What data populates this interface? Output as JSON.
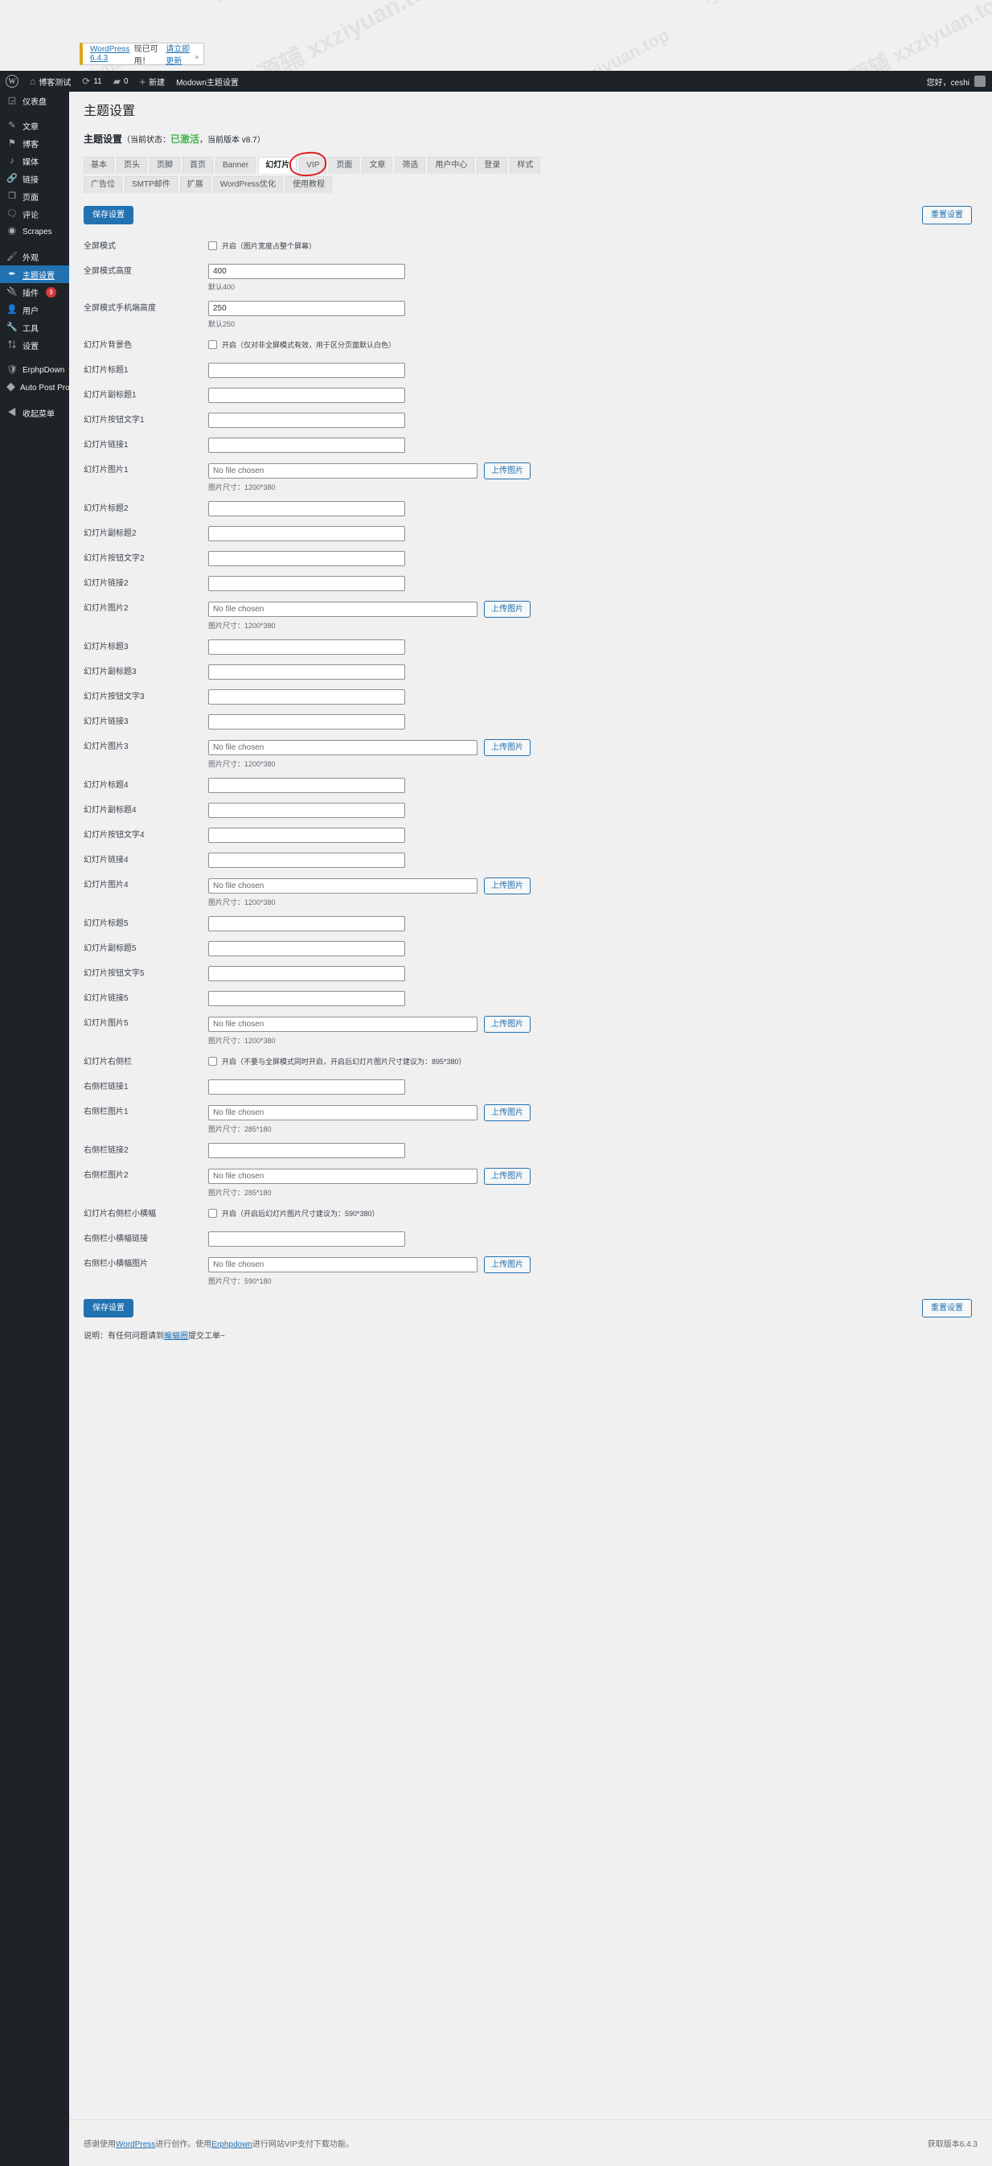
{
  "notice": {
    "text_prefix": "WordPress 6.4.3",
    "text_mid": "现已可用！",
    "link": "请立即更新",
    "text_suffix": "。"
  },
  "adminbar": {
    "logo_icon": "wordpress-logo-icon",
    "site_icon": "home-icon",
    "site_name": "博客测试",
    "updates_icon": "updates-icon",
    "updates_count": "11",
    "comments_icon": "comment-bubble-icon",
    "comments_count": "0",
    "new_icon": "plus-icon",
    "new_label": "新建",
    "theme_settings_label": "Modown主题设置",
    "greeting": "您好，ceshi",
    "avatar_icon": "avatar-icon"
  },
  "sidebar": {
    "items": [
      {
        "label": "仪表盘",
        "icon": "dashboard-icon",
        "glyph": "◲",
        "current": false,
        "badge": ""
      },
      {
        "label": "文章",
        "icon": "pin-icon",
        "glyph": "✎",
        "current": false,
        "badge": ""
      },
      {
        "label": "博客",
        "icon": "flag-icon",
        "glyph": "⚑",
        "current": false,
        "badge": ""
      },
      {
        "label": "媒体",
        "icon": "media-icon",
        "glyph": "♪",
        "current": false,
        "badge": ""
      },
      {
        "label": "链接",
        "icon": "link-icon",
        "glyph": "🔗",
        "current": false,
        "badge": ""
      },
      {
        "label": "页面",
        "icon": "page-icon",
        "glyph": "❐",
        "current": false,
        "badge": ""
      },
      {
        "label": "评论",
        "icon": "comment-icon",
        "glyph": "🗨",
        "current": false,
        "badge": ""
      },
      {
        "label": "Scrapes",
        "icon": "globe-cursor-icon",
        "glyph": "◉",
        "current": false,
        "badge": ""
      },
      {
        "label": "外观",
        "icon": "appearance-brush-icon",
        "glyph": "🖌",
        "current": false,
        "badge": ""
      },
      {
        "label": "主题设置",
        "icon": "theme-settings-icon",
        "glyph": "✒",
        "current": true,
        "badge": ""
      },
      {
        "label": "插件",
        "icon": "plugins-icon",
        "glyph": "🔌",
        "current": false,
        "badge": "9"
      },
      {
        "label": "用户",
        "icon": "users-icon",
        "glyph": "👤",
        "current": false,
        "badge": ""
      },
      {
        "label": "工具",
        "icon": "tools-wrench-icon",
        "glyph": "🔧",
        "current": false,
        "badge": ""
      },
      {
        "label": "设置",
        "icon": "settings-sliders-icon",
        "glyph": "⇅",
        "current": false,
        "badge": ""
      },
      {
        "label": "ErphpDown",
        "icon": "shield-icon",
        "glyph": "🛡",
        "current": false,
        "badge": ""
      },
      {
        "label": "Auto Post Pro",
        "icon": "autopost-icon",
        "glyph": "◆",
        "current": false,
        "badge": ""
      },
      {
        "label": "收起菜单",
        "icon": "collapse-icon",
        "glyph": "◀",
        "current": false,
        "badge": ""
      }
    ]
  },
  "page": {
    "title": "主题设置",
    "panel_title": "主题设置",
    "panel_meta_open": "（当前状态：",
    "panel_status": "已激活",
    "panel_meta_mid": "，当前版本 v8.7）"
  },
  "tabs": [
    {
      "label": "基本",
      "active": false
    },
    {
      "label": "页头",
      "active": false
    },
    {
      "label": "页脚",
      "active": false
    },
    {
      "label": "首页",
      "active": false
    },
    {
      "label": "Banner",
      "active": false
    },
    {
      "label": "幻灯片",
      "active": true
    },
    {
      "label": "VIP",
      "active": false
    },
    {
      "label": "页面",
      "active": false
    },
    {
      "label": "文章",
      "active": false
    },
    {
      "label": "筛选",
      "active": false
    },
    {
      "label": "用户中心",
      "active": false
    },
    {
      "label": "登录",
      "active": false
    },
    {
      "label": "样式",
      "active": false
    },
    {
      "label": "广告位",
      "active": false
    },
    {
      "label": "SMTP邮件",
      "active": false
    },
    {
      "label": "扩展",
      "active": false
    },
    {
      "label": "WordPress优化",
      "active": false
    },
    {
      "label": "使用教程",
      "active": false
    }
  ],
  "toolbar": {
    "save_label": "保存设置",
    "reset_label": "重置设置",
    "upload_label": "上传图片"
  },
  "form": {
    "rows": [
      {
        "type": "checkbox",
        "label": "全屏模式",
        "checked": false,
        "checkbox_text": "开启（图片宽度占整个屏幕）"
      },
      {
        "type": "text",
        "label": "全屏模式高度",
        "value": "400",
        "hint": "默认400",
        "wide": true
      },
      {
        "type": "text",
        "label": "全屏模式手机端高度",
        "value": "250",
        "hint": "默认250",
        "wide": true
      },
      {
        "type": "checkbox",
        "label": "幻灯片背景色",
        "checked": false,
        "checkbox_text": "开启（仅对非全屏模式有效，用于区分页面默认白色）"
      },
      {
        "type": "text",
        "label": "幻灯片标题1",
        "value": "",
        "hint": ""
      },
      {
        "type": "text",
        "label": "幻灯片副标题1",
        "value": "",
        "hint": ""
      },
      {
        "type": "text",
        "label": "幻灯片按钮文字1",
        "value": "",
        "hint": ""
      },
      {
        "type": "text",
        "label": "幻灯片链接1",
        "value": "",
        "hint": ""
      },
      {
        "type": "file",
        "label": "幻灯片图片1",
        "value": "No file chosen",
        "hint": "图片尺寸：1200*380"
      },
      {
        "type": "text",
        "label": "幻灯片标题2",
        "value": "",
        "hint": ""
      },
      {
        "type": "text",
        "label": "幻灯片副标题2",
        "value": "",
        "hint": ""
      },
      {
        "type": "text",
        "label": "幻灯片按钮文字2",
        "value": "",
        "hint": ""
      },
      {
        "type": "text",
        "label": "幻灯片链接2",
        "value": "",
        "hint": ""
      },
      {
        "type": "file",
        "label": "幻灯片图片2",
        "value": "No file chosen",
        "hint": "图片尺寸：1200*380"
      },
      {
        "type": "text",
        "label": "幻灯片标题3",
        "value": "",
        "hint": ""
      },
      {
        "type": "text",
        "label": "幻灯片副标题3",
        "value": "",
        "hint": ""
      },
      {
        "type": "text",
        "label": "幻灯片按钮文字3",
        "value": "",
        "hint": ""
      },
      {
        "type": "text",
        "label": "幻灯片链接3",
        "value": "",
        "hint": ""
      },
      {
        "type": "file",
        "label": "幻灯片图片3",
        "value": "No file chosen",
        "hint": "图片尺寸：1200*380"
      },
      {
        "type": "text",
        "label": "幻灯片标题4",
        "value": "",
        "hint": ""
      },
      {
        "type": "text",
        "label": "幻灯片副标题4",
        "value": "",
        "hint": ""
      },
      {
        "type": "text",
        "label": "幻灯片按钮文字4",
        "value": "",
        "hint": ""
      },
      {
        "type": "text",
        "label": "幻灯片链接4",
        "value": "",
        "hint": ""
      },
      {
        "type": "file",
        "label": "幻灯片图片4",
        "value": "No file chosen",
        "hint": "图片尺寸：1200*380"
      },
      {
        "type": "text",
        "label": "幻灯片标题5",
        "value": "",
        "hint": ""
      },
      {
        "type": "text",
        "label": "幻灯片副标题5",
        "value": "",
        "hint": ""
      },
      {
        "type": "text",
        "label": "幻灯片按钮文字5",
        "value": "",
        "hint": ""
      },
      {
        "type": "text",
        "label": "幻灯片链接5",
        "value": "",
        "hint": ""
      },
      {
        "type": "file",
        "label": "幻灯片图片5",
        "value": "No file chosen",
        "hint": "图片尺寸：1200*380"
      },
      {
        "type": "checkbox",
        "label": "幻灯片右侧栏",
        "checked": false,
        "checkbox_text": "开启（不要与全屏模式同时开启，开启后幻灯片图片尺寸建议为：895*380）"
      },
      {
        "type": "text",
        "label": "右侧栏链接1",
        "value": "",
        "hint": ""
      },
      {
        "type": "file",
        "label": "右侧栏图片1",
        "value": "No file chosen",
        "hint": "图片尺寸：285*180"
      },
      {
        "type": "text",
        "label": "右侧栏链接2",
        "value": "",
        "hint": ""
      },
      {
        "type": "file",
        "label": "右侧栏图片2",
        "value": "No file chosen",
        "hint": "图片尺寸：285*180"
      },
      {
        "type": "checkbox",
        "label": "幻灯片右侧栏小横幅",
        "checked": false,
        "checkbox_text": "开启（开启后幻灯片图片尺寸建议为：590*380）"
      },
      {
        "type": "text",
        "label": "右侧栏小横幅链接",
        "value": "",
        "hint": ""
      },
      {
        "type": "file",
        "label": "右侧栏小横幅图片",
        "value": "No file chosen",
        "hint": "图片尺寸：590*180"
      }
    ]
  },
  "footer_note": {
    "prefix": "说明：有任何问题请到",
    "link": "蝙蝠圈",
    "suffix": "提交工单~"
  },
  "page_footer": {
    "thanks_prefix": "感谢使用",
    "thanks_link1": "WordPress",
    "thanks_mid": "进行创作。使用",
    "thanks_link2": "Erphpdown",
    "thanks_suffix": "进行网站VIP支付下载功能。",
    "version": "获取版本6.4.3"
  },
  "watermark": {
    "text": "小lv小资源辅 xxziyuan.top",
    "color": "#787878"
  },
  "colors": {
    "accent": "#2271b1",
    "sidebar_bg": "#1d2327",
    "active_green": "#46b450",
    "badge_red": "#d63638",
    "notice_yellow": "#dba617",
    "circle_red": "#e02020"
  }
}
